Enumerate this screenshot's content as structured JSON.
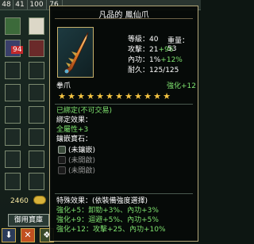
{
  "topbar": {
    "counts": [
      "48",
      "41",
      "100",
      "76"
    ]
  },
  "inventory": {
    "slot_count": "94",
    "money": "2460",
    "shop_button": "御用寶庫"
  },
  "tooltip": {
    "title": "凡品的 鳳仙爪",
    "stats": {
      "level": "等級：40",
      "weight": "重量：53",
      "attack_label": "攻擊：",
      "attack_value": "21",
      "attack_bonus": "+96",
      "speed_label": "內功：",
      "speed_value": "1%",
      "speed_bonus": "+12%",
      "durability": "耐久：125/125"
    },
    "type": "拳爪",
    "enhance": "強化+12",
    "stars_total": 12,
    "stars_filled": 12,
    "status_lines": [
      "已綁定(不可交易)",
      "綁定效果：",
      "全屬性+3",
      "鑲嵌寶石："
    ],
    "gem_slots": [
      "(未鑲嵌)",
      "(未開啟)",
      "(未開啟)"
    ],
    "special_header": "特殊效果：(依裝備強度選擇)",
    "special_effects": [
      "強化+5：卸勁+3%、內功+3%",
      "強化+9：迴避+5%、內功+5%",
      "強化+12：攻擊+25、內功+10%"
    ]
  },
  "colors": {
    "white": "#ffffff",
    "green": "#7fe36f",
    "gray": "#9a9a9a",
    "gold": "#f5c542",
    "border": "#b4a77a"
  }
}
